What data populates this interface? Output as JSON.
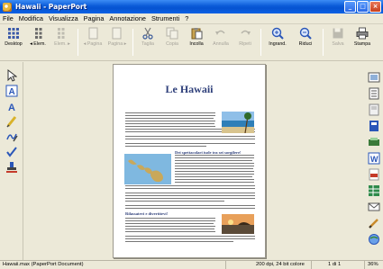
{
  "window": {
    "title": "Hawaii - PaperPort"
  },
  "menu": [
    "File",
    "Modifica",
    "Visualizza",
    "Pagina",
    "Annotazione",
    "Strumenti",
    "?"
  ],
  "toolbar": {
    "desktop": "Desktop",
    "prev_item": "Elem.",
    "next_item": "Elem.",
    "prev_page": "Pagina",
    "next_page": "Pagina",
    "cut": "Taglia",
    "copy": "Copia",
    "paste": "Incolla",
    "undo": "Annulla",
    "redo": "Ripeti",
    "zoom_in": "Ingrand.",
    "zoom_out": "Riduci",
    "save": "Salva",
    "print": "Stampa"
  },
  "document": {
    "title": "Le Hawaii",
    "subheading_1": "Dei spettacolari isole tra sei sorgilere!",
    "subheading_2": "Rilassatevi e divertitevi!"
  },
  "status": {
    "file": "Hawaii.max (PaperPort Document)",
    "resolution": "200 dpi, 24 bit colore",
    "page_info": "1 di 1",
    "zoom": "36%"
  },
  "colors": {
    "title_bar": "#0a5ad8",
    "doc_title": "#2e3f7a",
    "chrome": "#ece9d8"
  }
}
